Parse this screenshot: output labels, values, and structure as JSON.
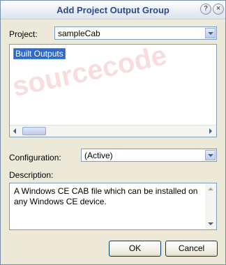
{
  "window": {
    "title": "Add Project Output Group",
    "help_glyph": "?",
    "close_glyph": "×"
  },
  "project": {
    "label": "Project:",
    "value": "sampleCab"
  },
  "outputs": {
    "items": [
      "Built Outputs"
    ],
    "watermark": "sourcecode"
  },
  "configuration": {
    "label": "Configuration:",
    "value": "(Active)"
  },
  "description": {
    "label": "Description:",
    "text": "A Windows CE CAB file which can be installed on any Windows CE device."
  },
  "buttons": {
    "ok": "OK",
    "cancel": "Cancel"
  },
  "icons": {
    "help": "help-icon",
    "close": "close-icon",
    "dropdown": "chevron-down-icon"
  },
  "colors": {
    "title_text": "#2e4a8a",
    "selection": "#316ac5",
    "border": "#7f9db9"
  }
}
